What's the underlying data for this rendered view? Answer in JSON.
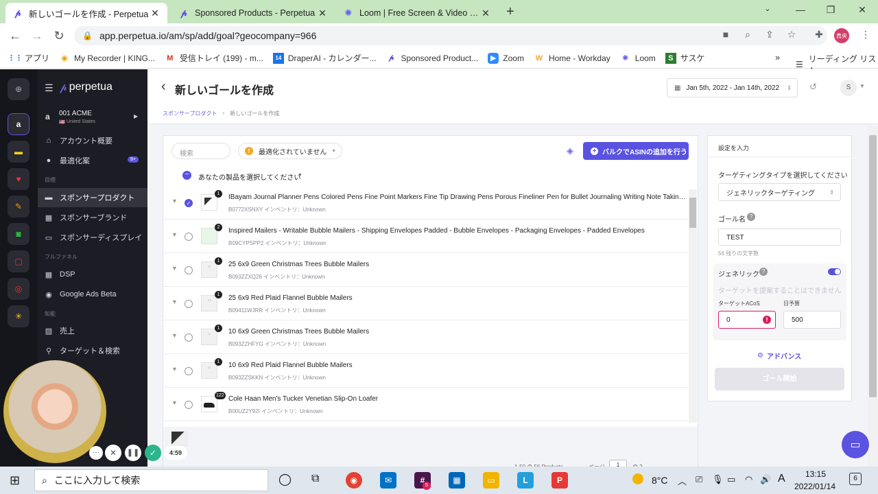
{
  "browser": {
    "tabs": [
      {
        "title": "新しいゴールを作成 - Perpetua",
        "active": true
      },
      {
        "title": "Sponsored Products - Perpetua",
        "active": false
      },
      {
        "title": "Loom | Free Screen & Video Reco",
        "active": false
      }
    ],
    "new_tab": "+",
    "url": "app.perpetua.io/am/sp/add/goal?geocompany=966",
    "profile_initials": "真央",
    "bookmarks": [
      {
        "label": "アプリ",
        "icon": "apps-grid-icon"
      },
      {
        "label": "My Recorder | KING...",
        "icon": "recorder-icon"
      },
      {
        "label": "受信トレイ (199) - m...",
        "icon": "gmail-icon"
      },
      {
        "label": "DraperAI - カレンダー...",
        "icon": "calendar-icon"
      },
      {
        "label": "Sponsored Product...",
        "icon": "perpetua-icon"
      },
      {
        "label": "Zoom",
        "icon": "zoom-icon"
      },
      {
        "label": "Home - Workday",
        "icon": "workday-icon"
      },
      {
        "label": "Loom",
        "icon": "loom-icon"
      },
      {
        "label": "サスケ",
        "icon": "saske-icon"
      }
    ],
    "bookmarks_more": "»",
    "reading_list": "リーディング リスト"
  },
  "app": {
    "logo": "perpetua",
    "account": {
      "name": "001 ACME",
      "country": "United States",
      "flag": "🇺🇸"
    },
    "nav": {
      "account_overview": "アカウント概要",
      "optimization": "最適化案",
      "optimization_badge": "9+",
      "section_goals": "目標",
      "sponsored_products": "スポンサープロダクト",
      "sponsored_brands": "スポンサーブランド",
      "sponsored_display": "スポンサーディスプレイ",
      "section_full_funnel": "フルファネル",
      "dsp": "DSP",
      "google_ads": "Google Ads Beta",
      "section_intelligence": "知能",
      "sales": "売上",
      "targeting": "ターゲット＆検索"
    },
    "header": {
      "back": "‹",
      "title": "新しいゴールを作成",
      "date_range": "Jan 5th, 2022 - Jan 14th, 2022",
      "user_initial": "S",
      "breadcrumb_root": "スポンサープロダクト",
      "breadcrumb_sep": "›",
      "breadcrumb_current": "新しいゴールを作成"
    },
    "products": {
      "search_placeholder": "検索",
      "filter_label": "最適化されていません",
      "bulk_button": "バルクでASINの追加を行う",
      "select_label": "あなたの製品を選択してください",
      "items": [
        {
          "title": "IBayam Journal Planner Pens Colored Pens Fine Point Markers Fine Tip Drawing Pens Porous Fineliner Pen for Bullet Journaling Writing Note Taking Calend...",
          "sub": "B0772XSNXY インベントリ：Unknown",
          "count": "1",
          "checked": true
        },
        {
          "title": "Inspired Mailers - Writable Bubble Mailers - Shipping Envelopes Padded - Bubble Envelopes - Packaging Envelopes - Padded Envelopes",
          "sub": "B09CYPSPP2 インベントリ：Unknown",
          "count": "2",
          "checked": false
        },
        {
          "title": "25 6x9 Green Christmas Trees Bubble Mailers",
          "sub": "B093ZZXQ26 インベントリ：Unknown",
          "count": "1",
          "checked": false
        },
        {
          "title": "25 6x9 Red Plaid Flannel Bubble Mailers",
          "sub": "B09411WJRR インベントリ：Unknown",
          "count": "1",
          "checked": false
        },
        {
          "title": "10 6x9 Green Christmas Trees Bubble Mailers",
          "sub": "B093ZZHFYG インベントリ：Unknown",
          "count": "1",
          "checked": false
        },
        {
          "title": "10 6x9 Red Plaid Flannel Bubble Mailers",
          "sub": "B093ZZSKKN インベントリ：Unknown",
          "count": "1",
          "checked": false
        },
        {
          "title": "Cole Haan Men's Tucker Venetian Slip-On Loafer",
          "sub": "B00UZ2Y92I インベントリ：Unknown",
          "count": "122",
          "checked": false
        }
      ],
      "pagination": "1-50 の 56 Products",
      "page_label": "ページ",
      "page_value": "1",
      "page_of": "の 2"
    },
    "settings": {
      "title": "設定を入力",
      "targeting_type_label": "ターゲティングタイプを選択してください",
      "targeting_type_value": "ジェネリックターゲティング",
      "goal_name_label": "ゴール名",
      "goal_name_value": "TEST",
      "chars_left": "56 残りの文字数",
      "generic_label": "ジェネリック",
      "generic_on": true,
      "target_hint": "ターゲットを提案することはできません",
      "acos_label": "ターゲットACoS",
      "acos_value": "0",
      "budget_label": "日予算",
      "budget_value": "500",
      "advanced": "アドバンス",
      "start_button": "ゴール開始"
    }
  },
  "loom": {
    "timer": "4:59"
  },
  "taskbar": {
    "search_placeholder": "ここに入力して検索",
    "temperature": "8°C",
    "ime": "A",
    "time": "13:15",
    "date": "2022/01/14",
    "notifications": "6",
    "slack_badge": "5"
  },
  "colors": {
    "accent": "#5a52e0",
    "sidebar": "#1c1d24",
    "rail": "#15161c",
    "tabstrip": "#c5e6bf",
    "error": "#d81b60"
  }
}
